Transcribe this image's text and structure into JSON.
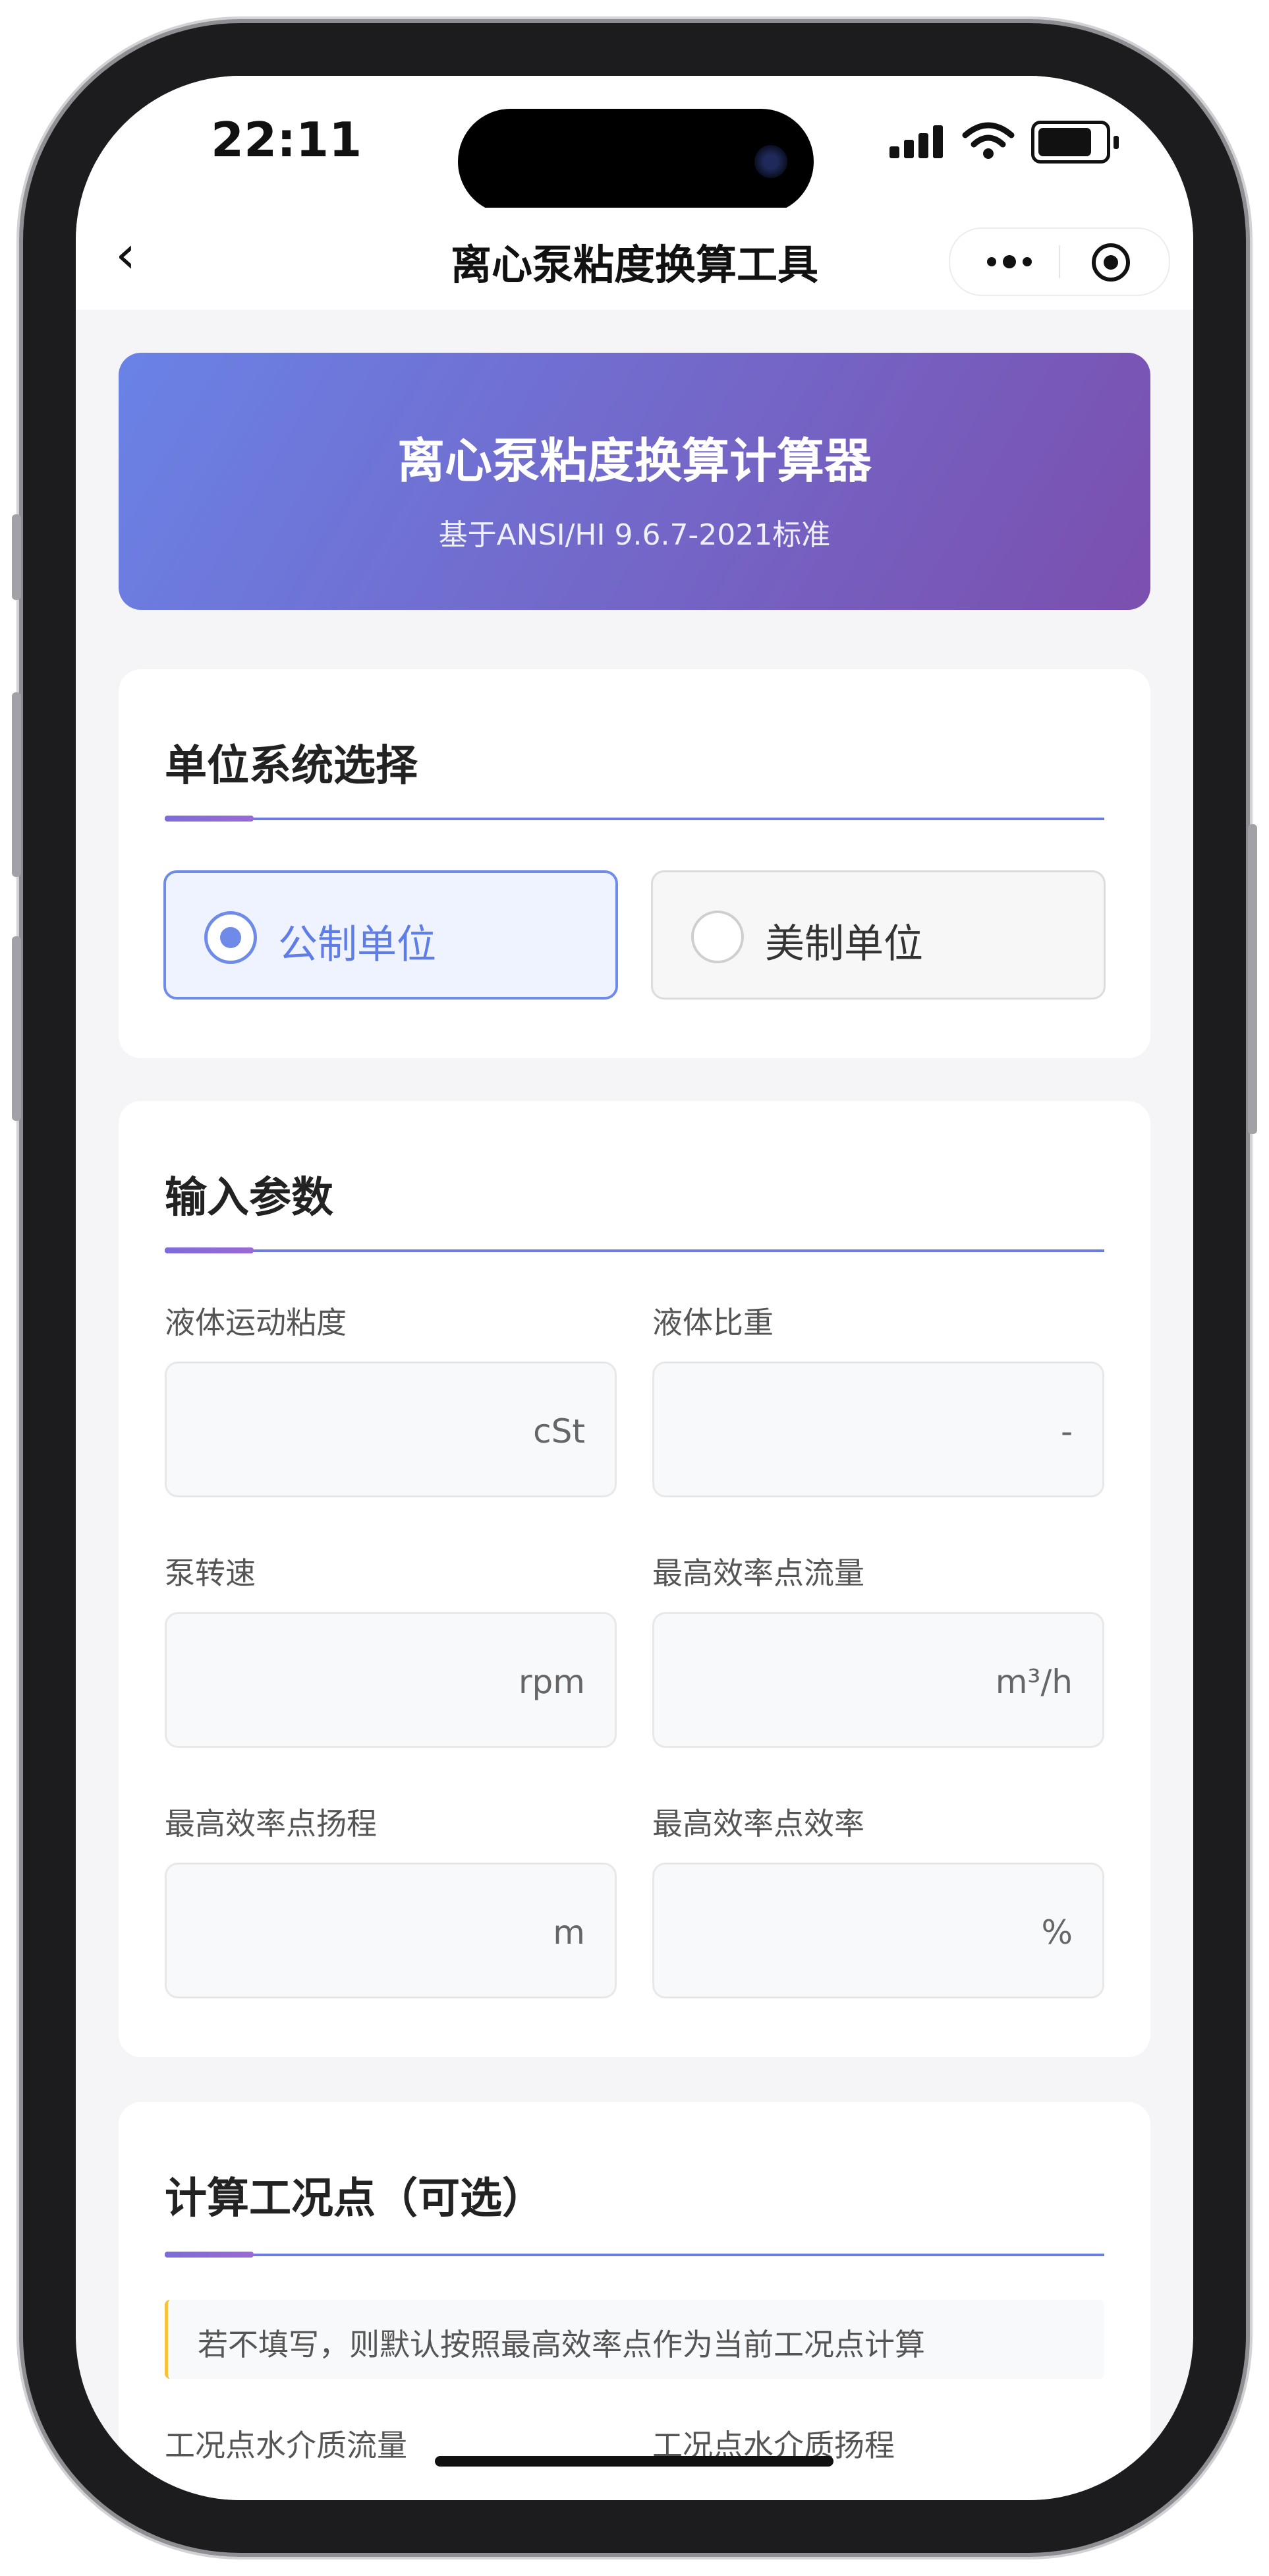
{
  "status_bar": {
    "time": "22:11"
  },
  "nav": {
    "back_glyph": "‹",
    "title": "离心泵粘度换算工具"
  },
  "banner": {
    "title": "离心泵粘度换算计算器",
    "subtitle": "基于ANSI/HI 9.6.7-2021标准"
  },
  "unit_card": {
    "title": "单位系统选择",
    "options": [
      {
        "label": "公制单位",
        "selected": true
      },
      {
        "label": "美制单位",
        "selected": false
      }
    ]
  },
  "input_card": {
    "title": "输入参数",
    "fields": [
      {
        "label": "液体运动粘度",
        "unit": "cSt",
        "value": ""
      },
      {
        "label": "液体比重",
        "unit": "-",
        "value": ""
      },
      {
        "label": "泵转速",
        "unit": "rpm",
        "value": ""
      },
      {
        "label": "最高效率点流量",
        "unit": "m³/h",
        "value": ""
      },
      {
        "label": "最高效率点扬程",
        "unit": "m",
        "value": ""
      },
      {
        "label": "最高效率点效率",
        "unit": "%",
        "value": ""
      }
    ]
  },
  "operating_card": {
    "title": "计算工况点（可选）",
    "tip": "若不填写，则默认按照最高效率点作为当前工况点计算",
    "fields": [
      {
        "label": "工况点水介质流量"
      },
      {
        "label": "工况点水介质扬程"
      }
    ]
  },
  "colors": {
    "accent": "#6f8be8",
    "banner_start": "#6a82e6",
    "banner_end": "#7b4fae",
    "tip_border": "#f4c33b"
  }
}
